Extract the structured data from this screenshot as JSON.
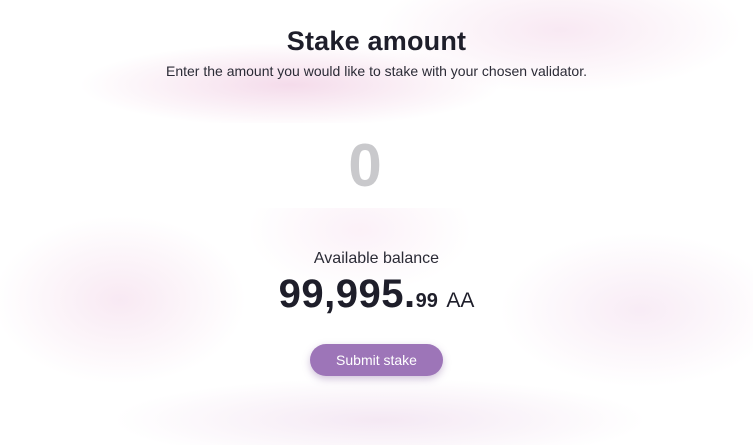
{
  "header": {
    "title": "Stake amount",
    "subtitle": "Enter the amount you would like to stake with your chosen validator."
  },
  "amount_field": {
    "value": "",
    "placeholder": "0"
  },
  "balance": {
    "label": "Available balance",
    "integer_part": "99,995.",
    "decimal_part": "99",
    "unit": "AA"
  },
  "actions": {
    "submit_label": "Submit stake"
  },
  "colors": {
    "accent": "#9d75b8",
    "text": "#1e1e2a",
    "placeholder": "#c9c9cc",
    "glow": "#ecbeda"
  }
}
